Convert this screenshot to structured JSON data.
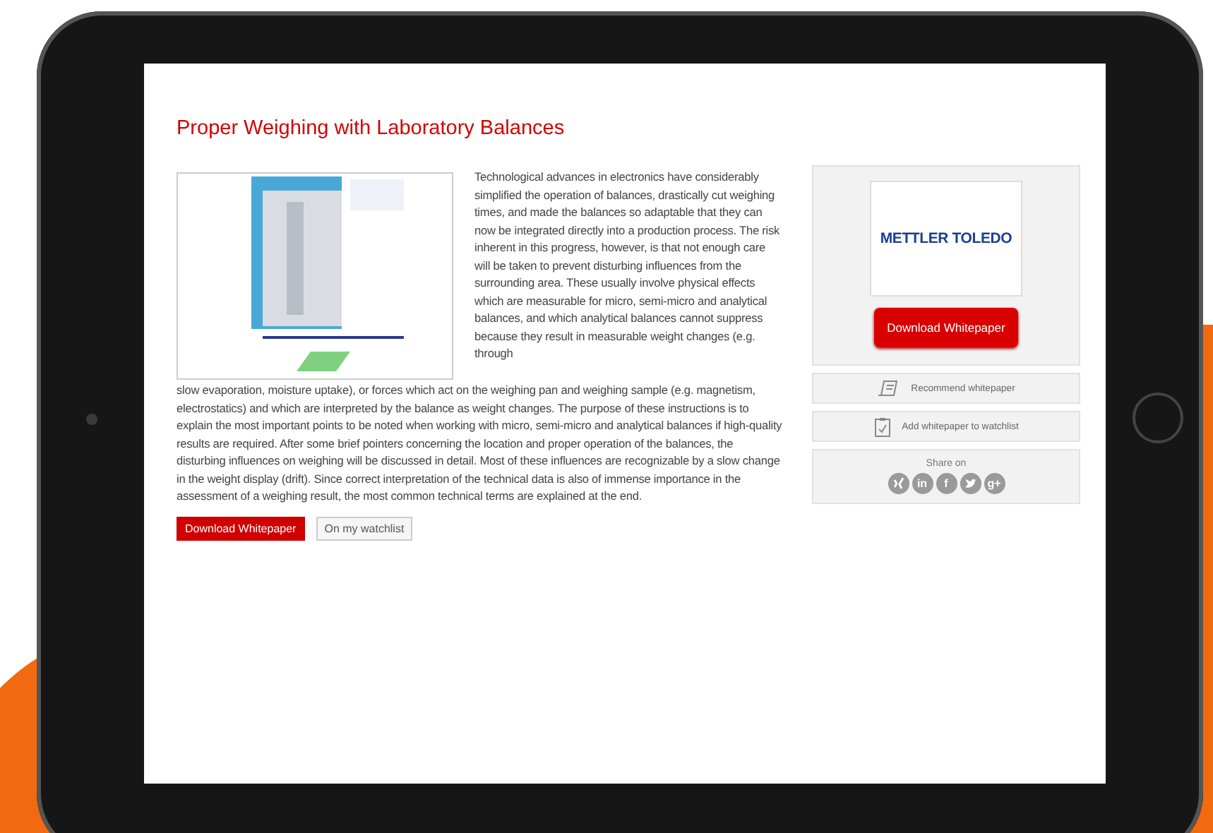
{
  "article": {
    "title": "Proper Weighing with Laboratory Balances",
    "body": [
      "Technological advances in electronics have considerably simplified the operation of balances, drastically cut weighing times, and made the balances so adaptable that they can now be integrated directly into a production process. The risk inherent in this progress, however, is that not enough care will be taken to prevent disturbing influences from the surrounding area. These usually involve physical effects which are measurable for micro, semi-micro and analytical balances, and which analytical balances cannot suppress because they result in measurable weight changes (e.g. through",
      "slow evaporation, moisture uptake), or forces which act on the weighing pan and weighing sample (e.g. magnetism, electrostatics) and which are interpreted by the balance as weight changes. The purpose of these instructions is to explain the most important points to be noted when working with micro, semi-micro and analytical balances if high-quality results are required. After some brief pointers concerning the location and proper operation of the balances, the disturbing influences on weighing will be discussed in detail. Most of these influences are recognizable by a slow change in the weight display (drift). Since correct interpretation of the technical data is also of immense importance in the assessment of a weighing result, the most common technical terms are explained at the end."
    ],
    "buttons": [
      {
        "label": "Download Whitepaper",
        "kind": "primary"
      },
      {
        "label": "On my watchlist",
        "kind": "secondary"
      }
    ]
  },
  "sidebar": {
    "logo": "METTLER TOLEDO",
    "download": "Download Whitepaper",
    "actions": [
      {
        "label": "Recommend whitepaper",
        "kind": "recommend"
      },
      {
        "label": "Add whitepaper to watchlist",
        "kind": "watchlist"
      }
    ],
    "share": {
      "label": "Share on",
      "networks": [
        {
          "kind": "xing"
        },
        {
          "kind": "linkedin",
          "label": "in"
        },
        {
          "kind": "facebook",
          "label": "f"
        },
        {
          "kind": "twitter"
        },
        {
          "kind": "googleplus",
          "label": "g+"
        }
      ]
    }
  }
}
